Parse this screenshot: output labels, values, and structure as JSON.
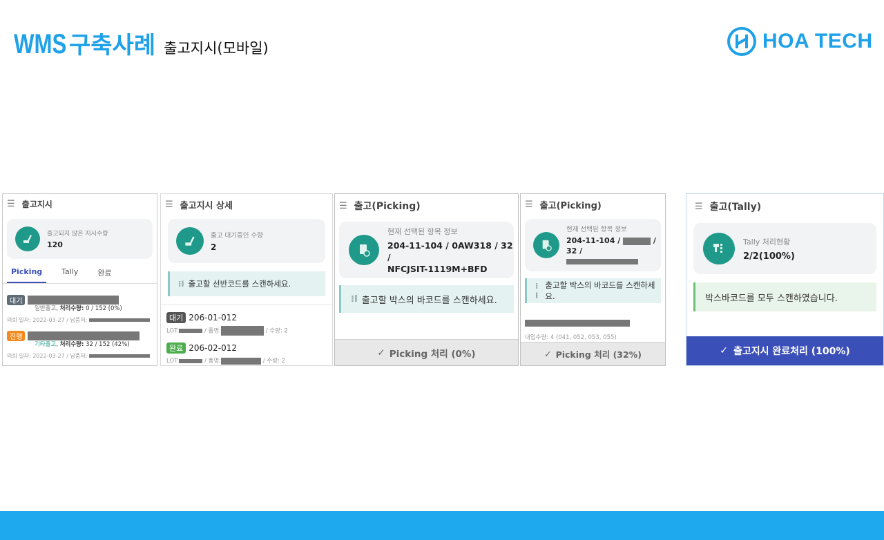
{
  "header": {
    "title_en": "WMS",
    "title_ko": "구축사례",
    "subtitle": "출고지시(모바일)",
    "brand": "HOA TECH"
  },
  "colors": {
    "accent": "#1ea1e8",
    "teal": "#1f9a8a",
    "primary_button": "#3b4fb8"
  },
  "panel1": {
    "title": "출고지시",
    "card_label": "출고되지 않은 지시수량",
    "card_value": "120",
    "tabs": [
      "Picking",
      "Tally",
      "완료"
    ],
    "rows": [
      {
        "badge": "대기",
        "type": "일반출고",
        "qty_label": "처리수량:",
        "qty": "0 / 152 (0%)",
        "date": "의뢰 일자: 2022-03-27 / 납품처:"
      },
      {
        "badge": "진행",
        "type": "기타출고",
        "qty_label": "처리수량:",
        "qty": "32 / 152 (42%)",
        "date": "의뢰 일자: 2022-03-27 / 납품처:"
      }
    ]
  },
  "panel2": {
    "title": "출고지시 상세",
    "card_label": "출고 대기중인 수량",
    "card_value": "2",
    "notice": "출고할 선반코드를 스캔하세요.",
    "rows": [
      {
        "badge": "대기",
        "code": "206-01-012",
        "lot": "LOT:",
        "item": "/ 품명:",
        "qty": "/ 수량: 2"
      },
      {
        "badge": "완료",
        "code": "206-02-012",
        "lot": "LOT:",
        "item": "/ 품명:",
        "qty": "/ 수량: 2"
      }
    ]
  },
  "panel3": {
    "title": "출고(Picking)",
    "card_label": "현재 선택된 항목 정보",
    "card_value_line1": "204-11-104 / 0AW318 / 32 /",
    "card_value_line2": "NFCJSIT-1119M+BFD",
    "notice": "출고할 박스의 바코드를 스캔하세요.",
    "button": "Picking 처리 (0%)"
  },
  "panel4": {
    "title": "출고(Picking)",
    "card_label": "현재 선택된 항목 정보",
    "card_value_prefix": "204-11-104 /",
    "card_value_suffix": "/ 32 /",
    "notice": "출고할 박스의 바코드를 스캔하세요.",
    "slot_detail": "내입수량: 4 (041, 052, 053, 055)",
    "button": "Picking 처리 (32%)"
  },
  "panel5": {
    "title": "출고(Tally)",
    "card_label": "Tally 처리현황",
    "card_value": "2/2(100%)",
    "notice": "박스바코드를 모두 스캔하였습니다.",
    "button": "출고지시 완료처리 (100%)"
  }
}
